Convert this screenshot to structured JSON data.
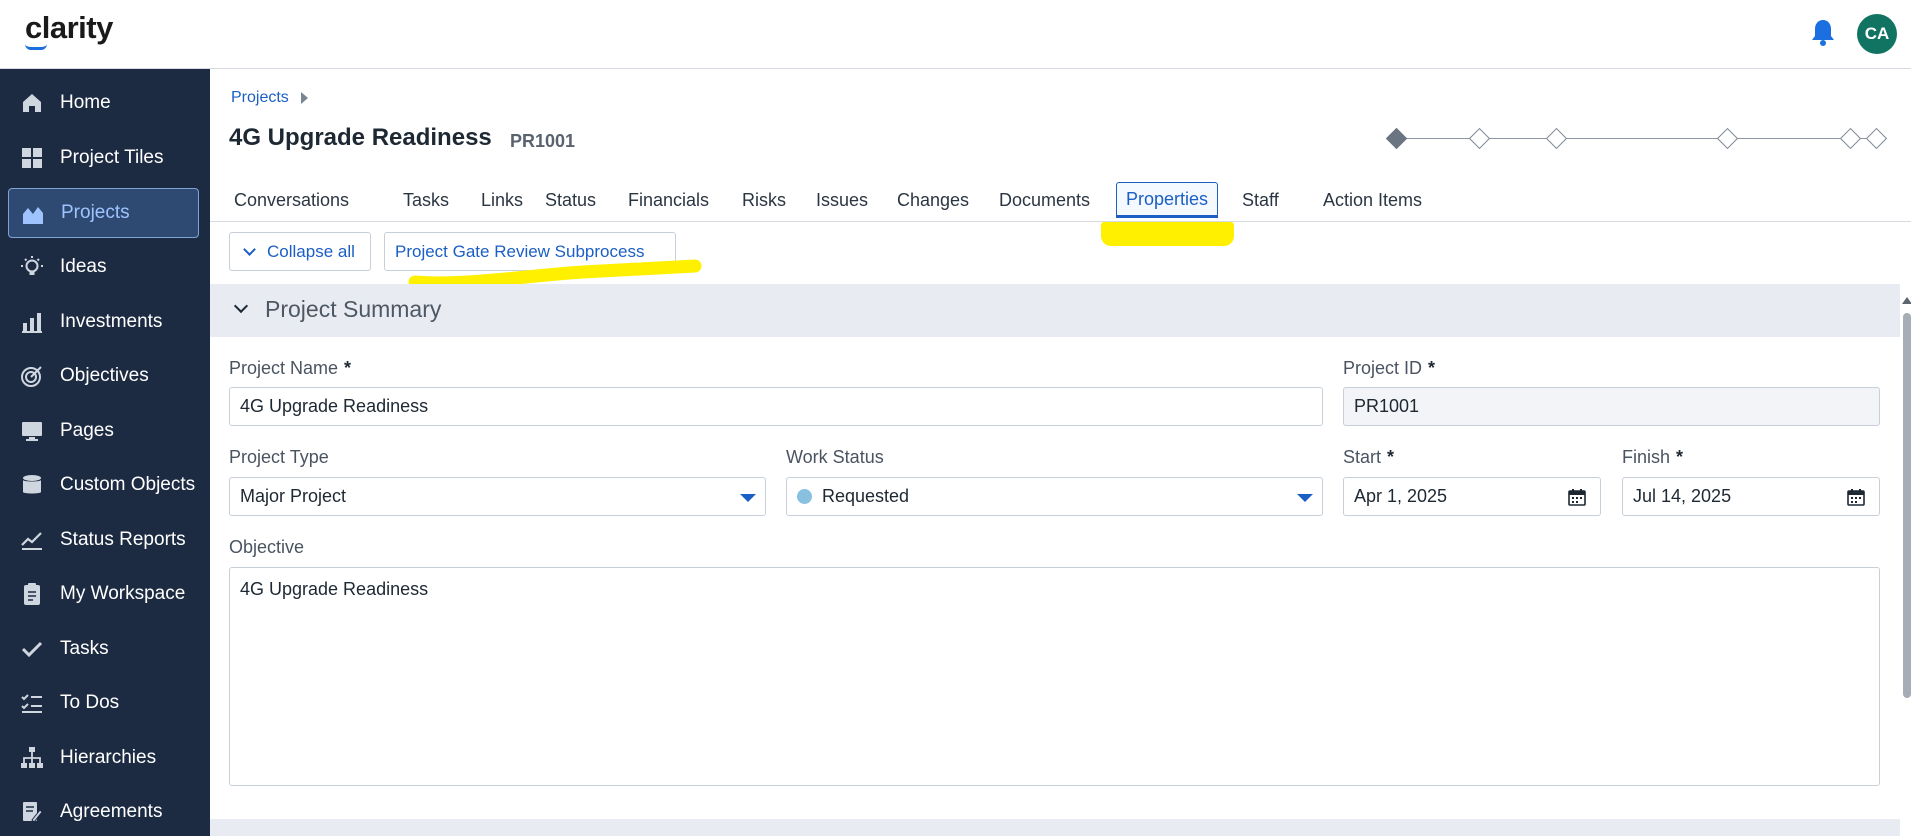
{
  "app": {
    "logo": "clarity",
    "user_initials": "CA"
  },
  "sidebar": {
    "items": [
      {
        "label": "Home",
        "icon": "home-icon"
      },
      {
        "label": "Project Tiles",
        "icon": "tiles-icon"
      },
      {
        "label": "Projects",
        "icon": "projects-icon",
        "active": true
      },
      {
        "label": "Ideas",
        "icon": "lightbulb-icon"
      },
      {
        "label": "Investments",
        "icon": "bar-chart-icon"
      },
      {
        "label": "Objectives",
        "icon": "target-icon"
      },
      {
        "label": "Pages",
        "icon": "monitor-icon"
      },
      {
        "label": "Custom Objects",
        "icon": "database-icon"
      },
      {
        "label": "Status Reports",
        "icon": "line-chart-icon"
      },
      {
        "label": "My Workspace",
        "icon": "clipboard-icon"
      },
      {
        "label": "Tasks",
        "icon": "checkmark-icon"
      },
      {
        "label": "To Dos",
        "icon": "checklist-icon"
      },
      {
        "label": "Hierarchies",
        "icon": "hierarchy-icon"
      },
      {
        "label": "Agreements",
        "icon": "agreement-icon"
      }
    ]
  },
  "header": {
    "breadcrumb": "Projects",
    "title": "4G Upgrade Readiness",
    "code": "PR1001"
  },
  "tabs": [
    {
      "label": "Conversations"
    },
    {
      "label": "Tasks"
    },
    {
      "label": "Links"
    },
    {
      "label": "Status"
    },
    {
      "label": "Financials"
    },
    {
      "label": "Risks"
    },
    {
      "label": "Issues"
    },
    {
      "label": "Changes"
    },
    {
      "label": "Documents"
    },
    {
      "label": "Properties",
      "active": true
    },
    {
      "label": "Staff"
    },
    {
      "label": "Action Items"
    }
  ],
  "toolbar": {
    "collapse_label": "Collapse all",
    "subprocess_label": "Project Gate Review Subprocess"
  },
  "section": {
    "title": "Project Summary"
  },
  "fields": {
    "project_name": {
      "label": "Project Name",
      "value": "4G Upgrade Readiness",
      "required": "*"
    },
    "project_id": {
      "label": "Project ID",
      "value": "PR1001",
      "required": "*"
    },
    "project_type": {
      "label": "Project Type",
      "value": "Major Project"
    },
    "work_status": {
      "label": "Work Status",
      "value": "Requested"
    },
    "start": {
      "label": "Start",
      "value": "Apr 1, 2025",
      "required": "*"
    },
    "finish": {
      "label": "Finish",
      "value": "Jul 14, 2025",
      "required": "*"
    },
    "objective": {
      "label": "Objective",
      "value": "4G Upgrade Readiness"
    }
  },
  "colors": {
    "sidebar_bg": "#1c2b42",
    "accent": "#1b5fc4",
    "highlight": "#fff000",
    "avatar_bg": "#117463"
  }
}
